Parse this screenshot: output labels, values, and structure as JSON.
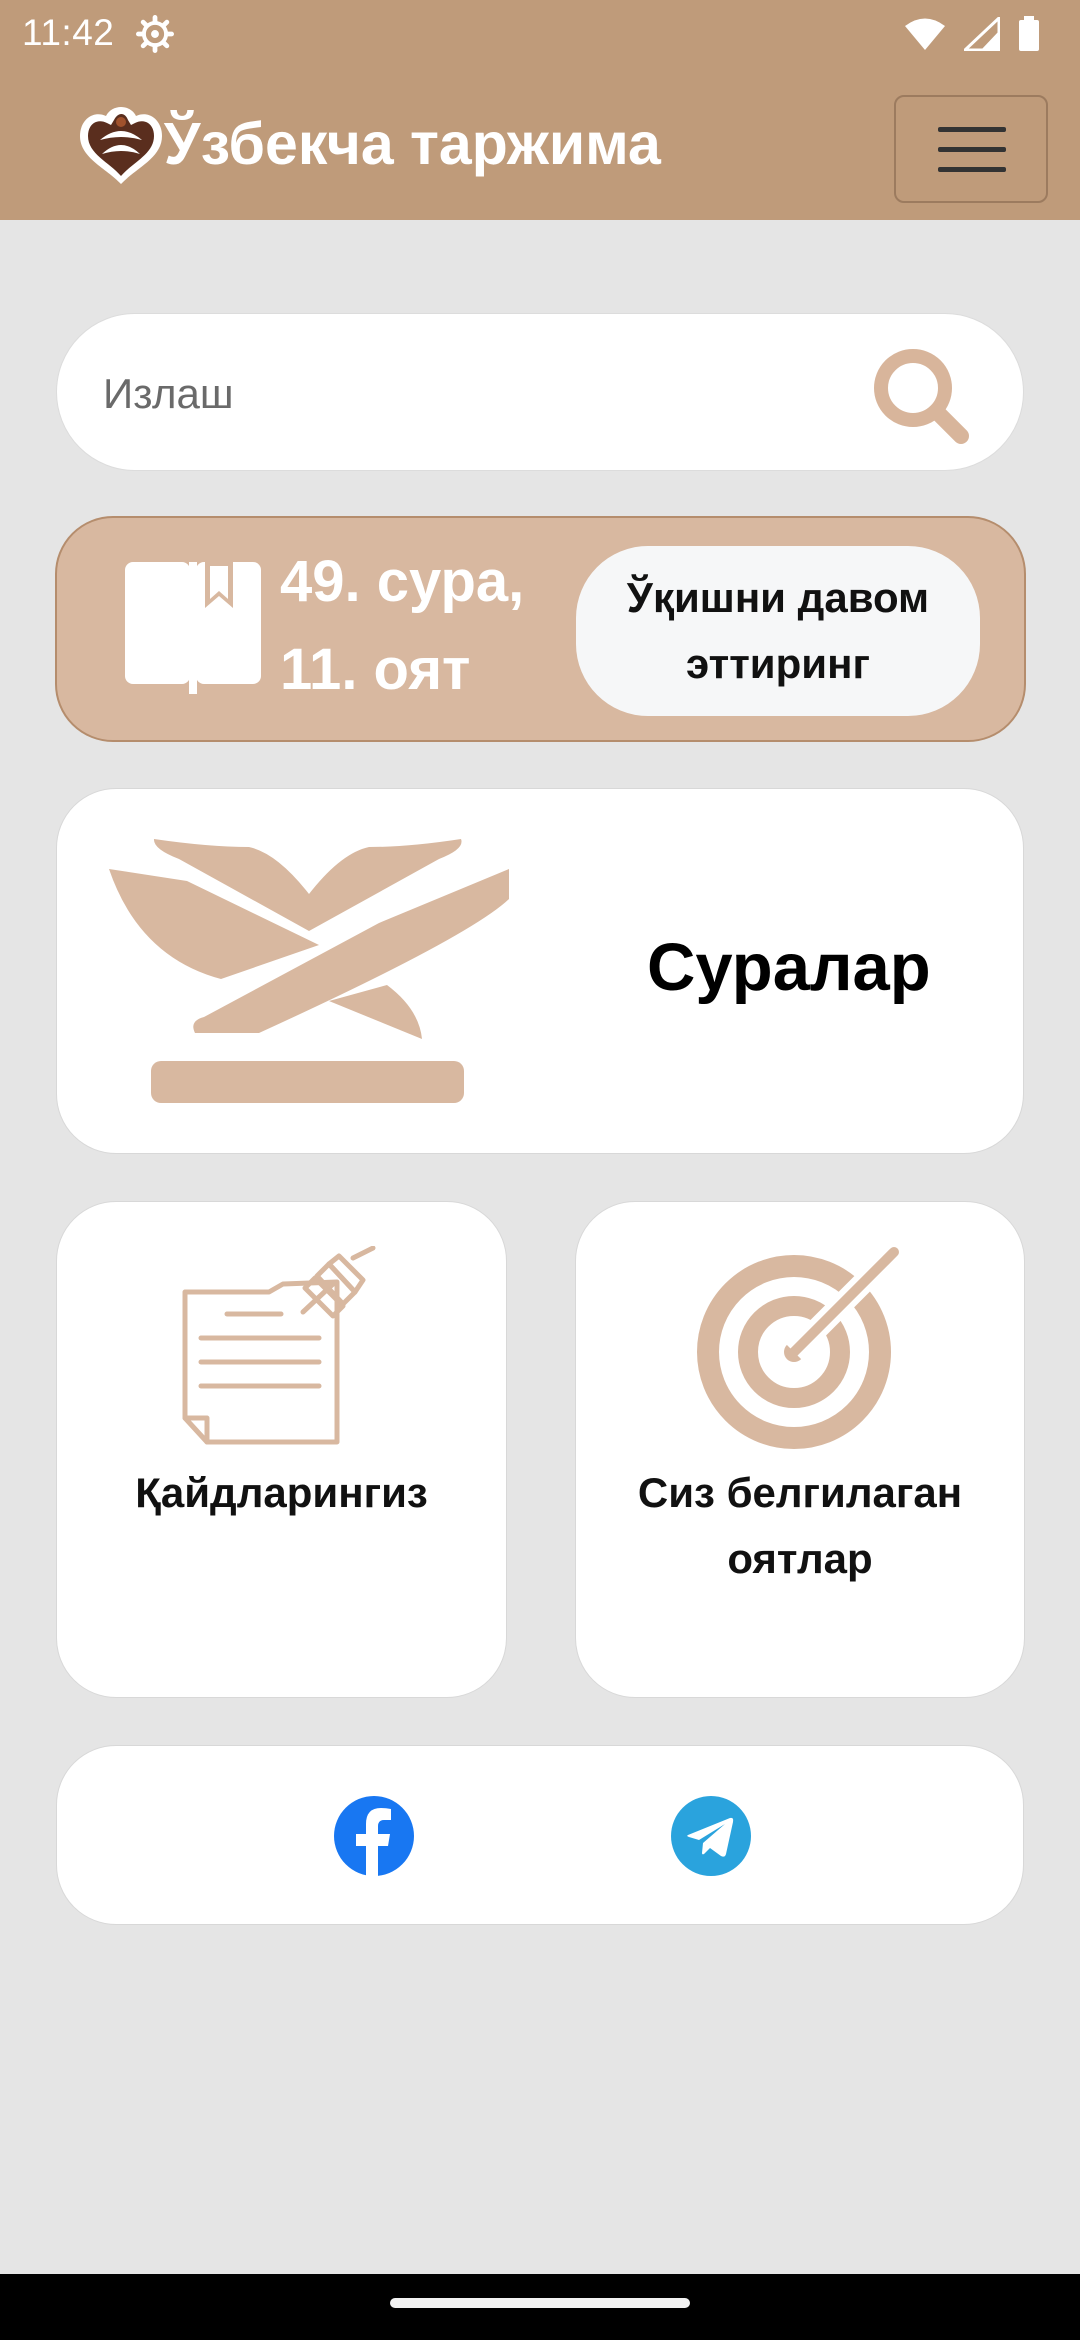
{
  "status_bar": {
    "time": "11:42",
    "icons": [
      "settings-gear-icon",
      "wifi-icon",
      "cellular-signal-icon",
      "battery-icon"
    ]
  },
  "header": {
    "title": "Ўзбекча таржима",
    "logo_icon": "logo-icon",
    "menu_icon": "hamburger-menu-icon"
  },
  "search": {
    "placeholder": "Излаш",
    "icon": "search-icon"
  },
  "continue_reading": {
    "surah_line": "49. сура,",
    "ayah_line": "11. оят",
    "button_line_1": "Ўқишни давом",
    "button_line_2": "эттиринг",
    "icon": "book-bookmark-icon"
  },
  "surahs": {
    "label": "Суралар",
    "icon": "quran-stand-icon"
  },
  "notes": {
    "label": "Қайдларингиз",
    "icon": "notes-pin-icon"
  },
  "marked": {
    "label_line_1": "Сиз белгилаган",
    "label_line_2": "оятлар",
    "icon": "target-icon"
  },
  "social": {
    "icons": [
      "facebook-icon",
      "telegram-icon"
    ]
  },
  "colors": {
    "brand": "#bf9b7a",
    "accent_light": "#d8b8a0",
    "background": "#e5e5e5",
    "facebook": "#1877f2",
    "telegram": "#2aa3dd"
  }
}
